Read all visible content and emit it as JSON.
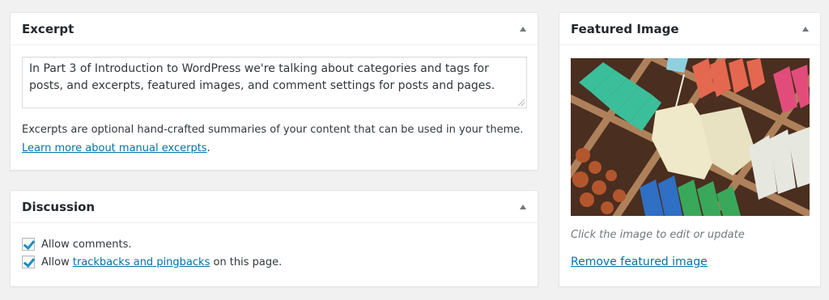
{
  "excerpt": {
    "title": "Excerpt",
    "text": "In Part 3 of Introduction to WordPress we're talking about categories and tags for posts, and excerpts, featured images, and comment settings for posts and pages.",
    "help_text": "Excerpts are optional hand-crafted summaries of your content that can be used in your theme.",
    "help_link": "Learn more about manual excerpts"
  },
  "discussion": {
    "title": "Discussion",
    "allow_comments": "Allow comments.",
    "allow_prefix": "Allow",
    "trackbacks_link": "trackbacks and pingbacks",
    "allow_suffix": "on this page."
  },
  "featured_image": {
    "title": "Featured Image",
    "caption": "Click the image to edit or update",
    "remove_link": "Remove featured image"
  },
  "colors": {
    "link": "#0073aa",
    "checkmark": "#1e8cbe"
  }
}
